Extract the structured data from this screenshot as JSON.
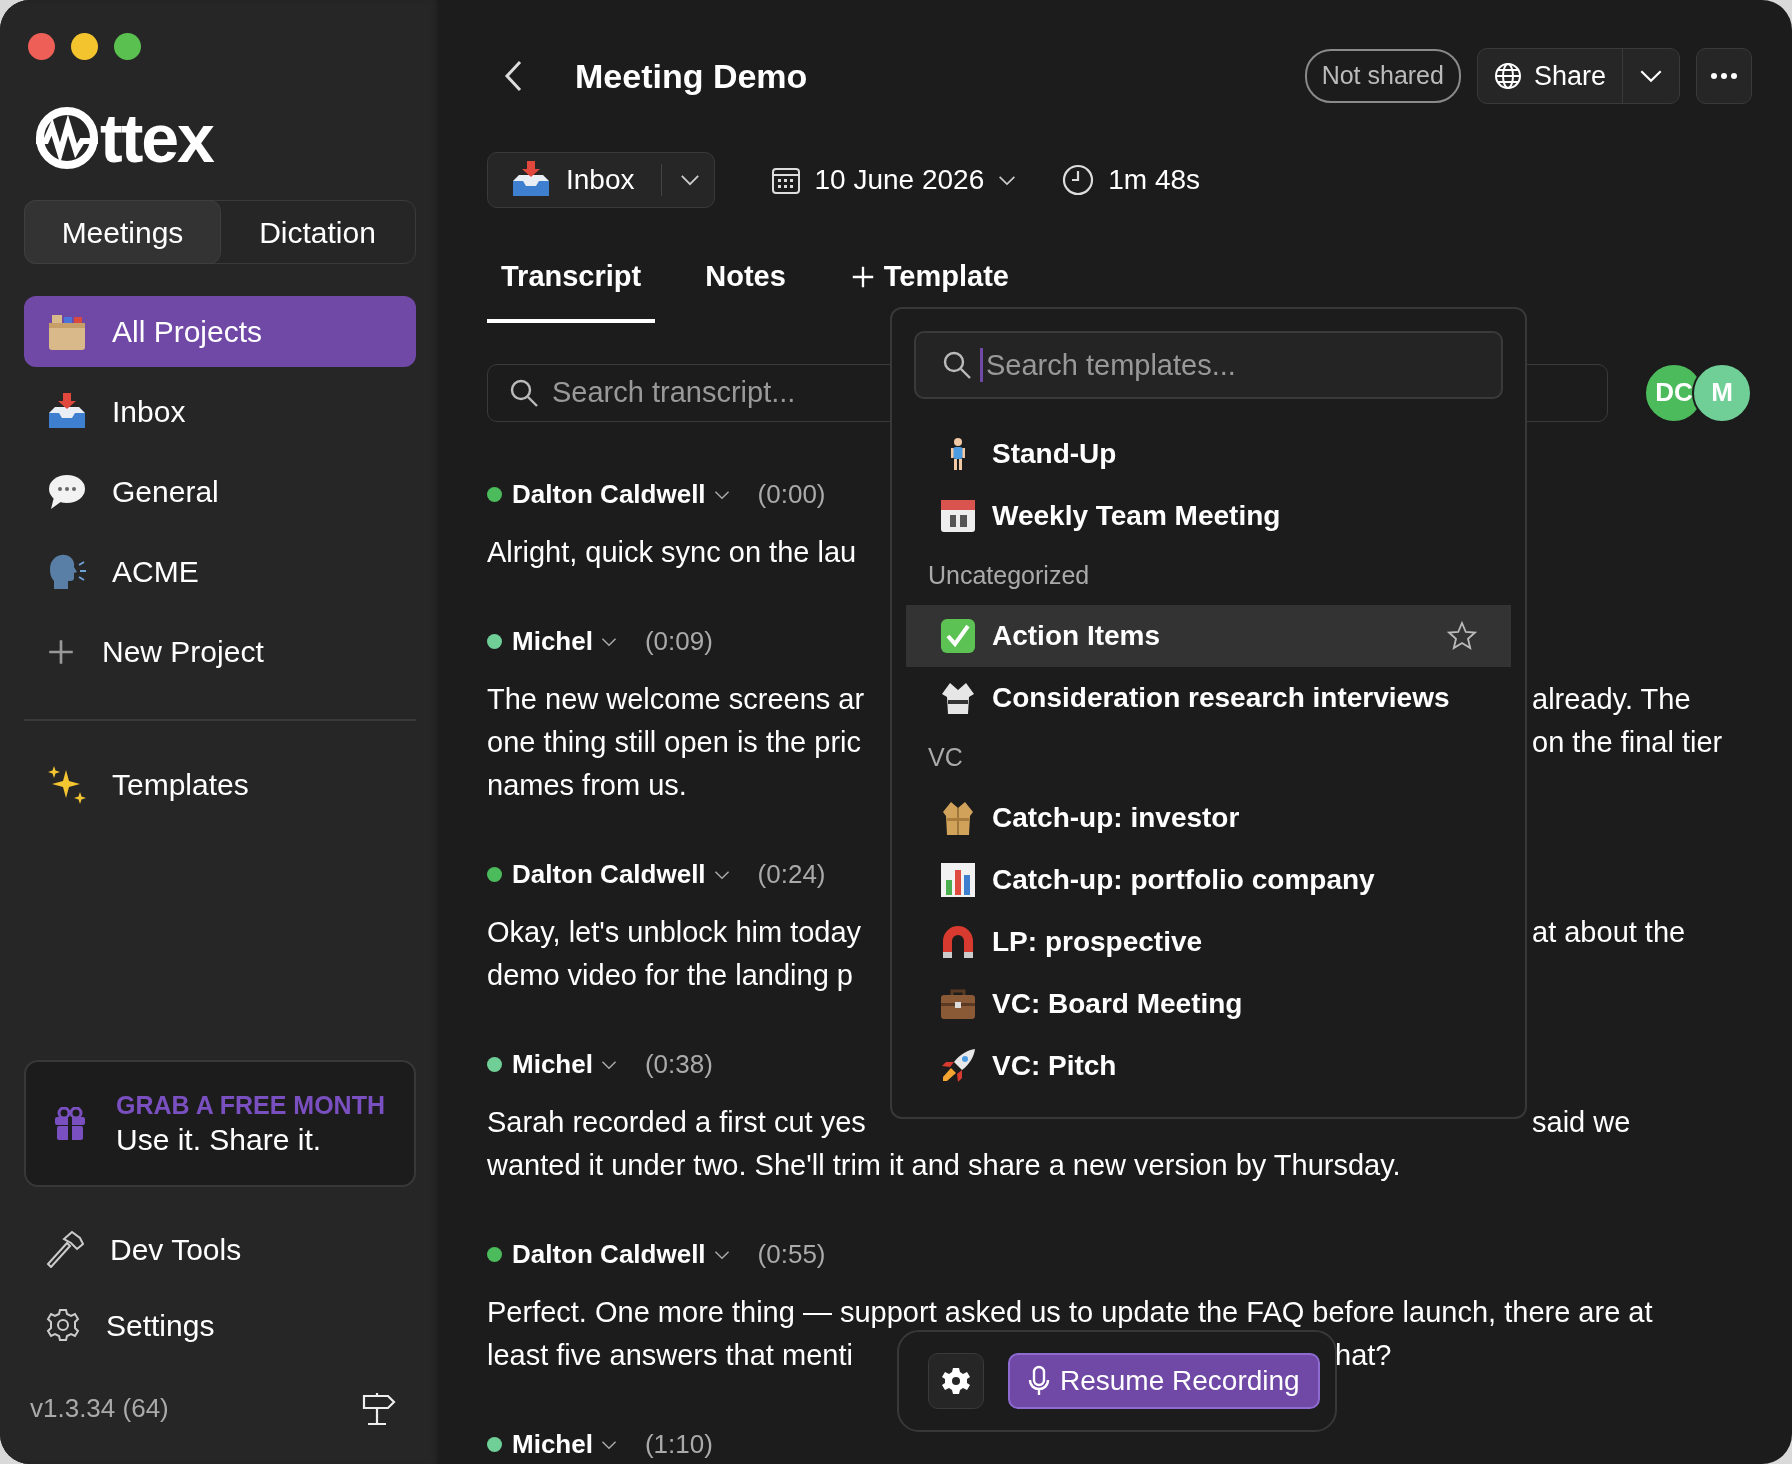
{
  "sidebar": {
    "logo": "ttex",
    "mode_tabs": [
      {
        "label": "Meetings",
        "selected": true
      },
      {
        "label": "Dictation",
        "selected": false
      }
    ],
    "projects": [
      {
        "label": "All Projects",
        "selected": true
      },
      {
        "label": "Inbox",
        "selected": false
      },
      {
        "label": "General",
        "selected": false
      },
      {
        "label": "ACME",
        "selected": false
      }
    ],
    "new_project": "New Project",
    "templates": "Templates",
    "promo": {
      "title": "GRAB A FREE MONTH",
      "subtitle": "Use it. Share it."
    },
    "footer_items": [
      "Dev Tools",
      "Settings"
    ],
    "version": "v1.3.34 (64)"
  },
  "header": {
    "title": "Meeting Demo",
    "share_status": "Not shared",
    "share_button": "Share",
    "project": "Inbox",
    "date": "10 June 2026",
    "duration": "1m 48s"
  },
  "tabs": [
    {
      "label": "Transcript",
      "kind": "tab",
      "selected": true
    },
    {
      "label": "Notes",
      "kind": "tab",
      "selected": false
    },
    {
      "label": "Template",
      "kind": "add",
      "selected": false
    }
  ],
  "search": {
    "placeholder": "Search transcript..."
  },
  "participants": [
    {
      "initials": "DC",
      "color": "#4cbb5c"
    },
    {
      "initials": "M",
      "color": "#6fcf97"
    }
  ],
  "transcript": [
    {
      "speaker": "Dalton Caldwell",
      "time": "(0:00)",
      "color": "#4cbb5c",
      "lines": [
        {
          "kind": "split_menu",
          "left": "Alright, quick sync on the lau"
        }
      ]
    },
    {
      "speaker": "Michel",
      "time": "(0:09)",
      "color": "#6fcf97",
      "lines": [
        {
          "kind": "split_menu",
          "left": "The new welcome screens ar",
          "right": "already. The"
        },
        {
          "kind": "split_menu",
          "left": "one thing still open is the pric",
          "right": "on the final tier"
        },
        {
          "kind": "full",
          "left": "names from us."
        }
      ]
    },
    {
      "speaker": "Dalton Caldwell",
      "time": "(0:24)",
      "color": "#4cbb5c",
      "lines": [
        {
          "kind": "split_menu",
          "left": "Okay, let's unblock him today",
          "right": "at about the"
        },
        {
          "kind": "split_menu",
          "left": "demo video for the landing p"
        }
      ]
    },
    {
      "speaker": "Michel",
      "time": "(0:38)",
      "color": "#6fcf97",
      "lines": [
        {
          "kind": "split_menu",
          "left": "Sarah recorded a first cut yes",
          "right": "said we"
        },
        {
          "kind": "full",
          "left": "wanted it under two. She'll trim it and share a new version by Thursday."
        }
      ]
    },
    {
      "speaker": "Dalton Caldwell",
      "time": "(0:55)",
      "color": "#4cbb5c",
      "lines": [
        {
          "kind": "full",
          "left": "Perfect. One more thing — support asked us to update the FAQ before launch, there are at"
        },
        {
          "kind": "split_bar",
          "left": "least five answers that menti",
          "right": "hat?"
        }
      ]
    },
    {
      "speaker": "Michel",
      "time": "(1:10)",
      "color": "#6fcf97"
    }
  ],
  "template_menu": {
    "placeholder": "Search templates...",
    "groups": [
      {
        "items": [
          {
            "label": "Stand-Up",
            "selected": false
          },
          {
            "label": "Weekly Team Meeting",
            "selected": false
          }
        ]
      },
      {
        "heading": "Uncategorized",
        "items": [
          {
            "label": "Action Items",
            "selected": true
          },
          {
            "label": "Consideration research interviews",
            "selected": false
          }
        ]
      },
      {
        "heading": "VC",
        "items": [
          {
            "label": "Catch-up: investor",
            "selected": false
          },
          {
            "label": "Catch-up: portfolio company",
            "selected": false
          },
          {
            "label": "LP: prospective",
            "selected": false
          },
          {
            "label": "VC: Board Meeting",
            "selected": false
          },
          {
            "label": "VC: Pitch",
            "selected": false
          }
        ]
      }
    ]
  },
  "recording_bar": {
    "button": "Resume Recording"
  }
}
